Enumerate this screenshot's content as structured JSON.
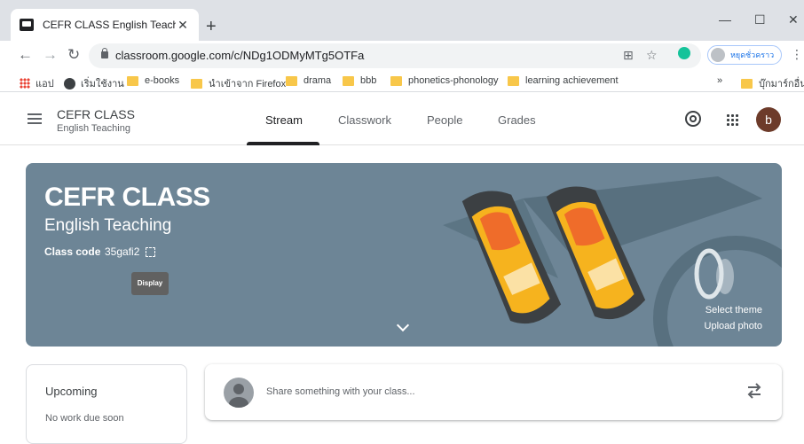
{
  "browser": {
    "tab_title": "CEFR CLASS English Teaching",
    "tab_close": "✕",
    "new_tab": "+",
    "win_minimize": "—",
    "win_maximize": "☐",
    "win_close": "✕",
    "url": "classroom.google.com/c/NDg1ODMyMTg5OTFa",
    "profile_label": "หยุดชั่วคราว",
    "icons": [
      "back-icon",
      "forward-icon",
      "reload-icon",
      "lock-icon",
      "translate-icon",
      "star-icon",
      "grammarly-icon",
      "more-icon"
    ]
  },
  "bookmarks": {
    "items": [
      {
        "label": "แอป"
      },
      {
        "label": "เริ่มใช้งาน"
      },
      {
        "label": "e-books"
      },
      {
        "label": "นำเข้าจาก Firefox"
      },
      {
        "label": "drama"
      },
      {
        "label": "bbb"
      },
      {
        "label": "phonetics-phonology"
      },
      {
        "label": "learning achievement"
      }
    ],
    "overflow": "»",
    "other": "บุ๊กมาร์กอื่นๆ"
  },
  "header": {
    "class_name": "CEFR CLASS",
    "class_sub": "English Teaching",
    "tabs": [
      {
        "label": "Stream",
        "active": true
      },
      {
        "label": "Classwork",
        "active": false
      },
      {
        "label": "People",
        "active": false
      },
      {
        "label": "Grades",
        "active": false
      }
    ],
    "avatar_letter": "b"
  },
  "banner": {
    "title": "CEFR CLASS",
    "subtitle": "English Teaching",
    "code_label": "Class code",
    "code": "35gafi2",
    "tooltip": "Display",
    "select_theme": "Select theme",
    "upload_photo": "Upload photo",
    "color": "#6d8596"
  },
  "upcoming": {
    "title": "Upcoming",
    "empty": "No work due soon"
  },
  "share": {
    "placeholder": "Share something with your class..."
  }
}
